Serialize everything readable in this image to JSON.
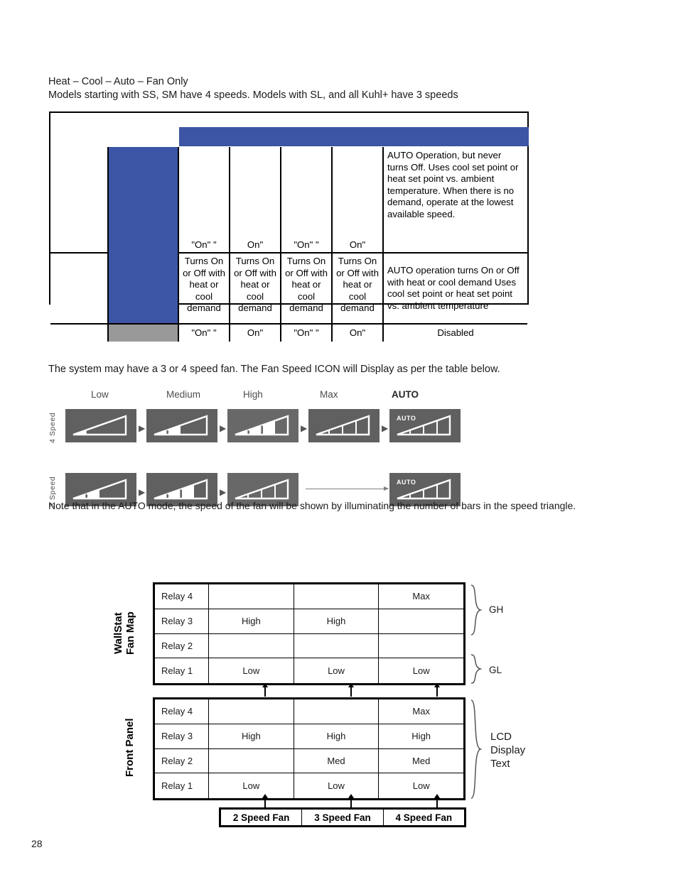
{
  "page_number": "28",
  "intro": {
    "line1": "Heat – Cool – Auto – Fan Only",
    "line2": "Models starting with SS, SM have 4 speeds. Models with SL, and all Kuhl+ have 3 speeds"
  },
  "mode_table": {
    "rows": [
      {
        "label": "",
        "speeds": [
          "\"On\" \"",
          "On\"",
          "\"On\" \"",
          "On\""
        ],
        "description": "AUTO Operation, but never turns Off. Uses cool set point or heat set point vs. ambient temperature. When there is no demand, operate at the lowest available speed."
      },
      {
        "label": "",
        "speeds": [
          "Turns On or Off with heat or cool demand",
          "Turns On or Off with heat or cool demand",
          "Turns On or Off with heat or cool demand",
          "Turns On or Off with heat or cool demand"
        ],
        "description": "AUTO operation turns On or Off with heat or cool demand Uses cool set point or heat set point vs. ambient temperature"
      },
      {
        "label": "",
        "speeds": [
          "\"On\" \"",
          "On\"",
          "\"On\" \"",
          "On\""
        ],
        "description": "Disabled"
      }
    ],
    "accent_blue": "#3c55a5",
    "accent_gray": "#999999"
  },
  "fan_icons": {
    "intro_text": "The system may have a 3 or 4 speed fan. The Fan Speed ICON will Display as per the table below.",
    "column_headers": [
      "Low",
      "Medium",
      "High",
      "Max",
      "AUTO"
    ],
    "rows": [
      {
        "label": "4 Speed",
        "icons": [
          {
            "name": "fan-speed-low-icon",
            "segments": 4,
            "filled": 1,
            "auto": false
          },
          {
            "name": "fan-speed-medium-icon",
            "segments": 4,
            "filled": 2,
            "auto": false
          },
          {
            "name": "fan-speed-high-icon",
            "segments": 4,
            "filled": 3,
            "auto": false
          },
          {
            "name": "fan-speed-max-icon",
            "segments": 4,
            "filled": 4,
            "auto": false
          },
          {
            "name": "fan-speed-auto-icon",
            "segments": 4,
            "filled": 4,
            "auto": true
          }
        ]
      },
      {
        "label": "3 Speed",
        "icons": [
          {
            "name": "fan-speed-low-icon",
            "segments": 4,
            "filled": 2,
            "auto": false
          },
          {
            "name": "fan-speed-medium-icon",
            "segments": 4,
            "filled": 3,
            "auto": false
          },
          {
            "name": "fan-speed-high-icon",
            "segments": 4,
            "filled": 4,
            "auto": false
          },
          {
            "name": "fan-speed-auto-icon",
            "segments": 4,
            "filled": 4,
            "auto": true
          }
        ]
      }
    ],
    "auto_badge_text": "AUTO",
    "note": "Note that in the AUTO mode, the speed of the fan will be shown by illuminating the number of bars in the speed triangle."
  },
  "relay_diagram": {
    "wallstat_label": "WallStat\nFan Map",
    "wallstat_label_line1": "WallStat",
    "wallstat_label_line2": "Fan Map",
    "front_panel_label": "Front Panel",
    "wallstat_rows": [
      {
        "relay": "Relay 4",
        "c1": "",
        "c2": "",
        "c3": "Max"
      },
      {
        "relay": "Relay 3",
        "c1": "High",
        "c2": "High",
        "c3": ""
      },
      {
        "relay": "Relay 2",
        "c1": "",
        "c2": "",
        "c3": ""
      },
      {
        "relay": "Relay 1",
        "c1": "Low",
        "c2": "Low",
        "c3": "Low"
      }
    ],
    "front_panel_rows": [
      {
        "relay": "Relay 4",
        "c1": "",
        "c2": "",
        "c3": "Max"
      },
      {
        "relay": "Relay 3",
        "c1": "High",
        "c2": "High",
        "c3": "High"
      },
      {
        "relay": "Relay 2",
        "c1": "",
        "c2": "Med",
        "c3": "Med"
      },
      {
        "relay": "Relay 1",
        "c1": "Low",
        "c2": "Low",
        "c3": "Low"
      }
    ],
    "footer": [
      "2 Speed Fan",
      "3 Speed Fan",
      "4 Speed Fan"
    ],
    "brace_gh": "GH",
    "brace_gl": "GL",
    "brace_lcd_line1": "LCD",
    "brace_lcd_line2": "Display",
    "brace_lcd_line3": "Text"
  }
}
